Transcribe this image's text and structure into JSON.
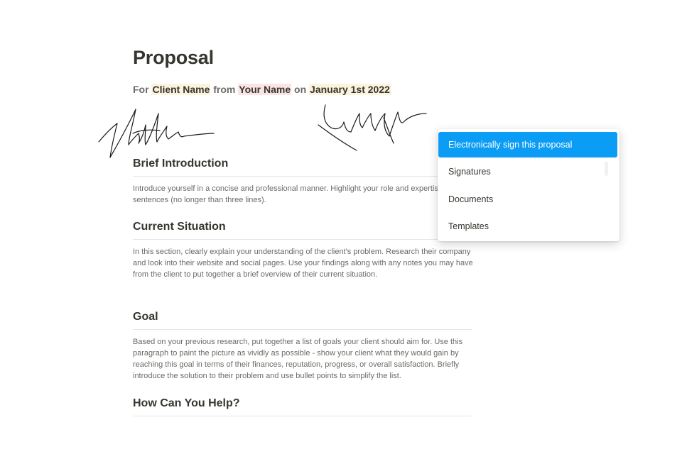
{
  "document": {
    "title": "Proposal",
    "subtitle": {
      "for": "For",
      "client": "Client Name",
      "from": "from",
      "author": "Your Name",
      "on": "on",
      "date": "January 1st 2022"
    },
    "sections": [
      {
        "heading": "Brief Introduction",
        "body": "Introduce yourself in a concise and professional manner. Highlight your role and expertise in a few sentences (no longer than three lines)."
      },
      {
        "heading": "Current Situation",
        "body": "In this section, clearly explain your understanding of the client's problem. Research their company and look into their website and social pages. Use your findings along with any notes you may have from the client to put together a brief overview of their current situation."
      },
      {
        "heading": "Goal",
        "body": "Based on your previous research, put together a list of goals your client should aim for. Use this paragraph to paint the picture as vividly as possible - show your client what they would gain by reaching this goal in terms of their finances, reputation, progress, or overall satisfaction. Briefly introduce the solution to their problem and use bullet points to simplify the list."
      },
      {
        "heading": "How Can You Help?"
      }
    ]
  },
  "menu": {
    "items": [
      {
        "label": "Electronically sign this proposal",
        "active": true
      },
      {
        "label": "Signatures"
      },
      {
        "label": "Documents"
      },
      {
        "label": "Templates"
      }
    ],
    "accent_color": "#0b9cf5"
  },
  "colors": {
    "text": "#37352f",
    "muted": "#6b6a66",
    "highlight_yellow": "#fbf3db",
    "highlight_pink": "#fbe4e4"
  }
}
